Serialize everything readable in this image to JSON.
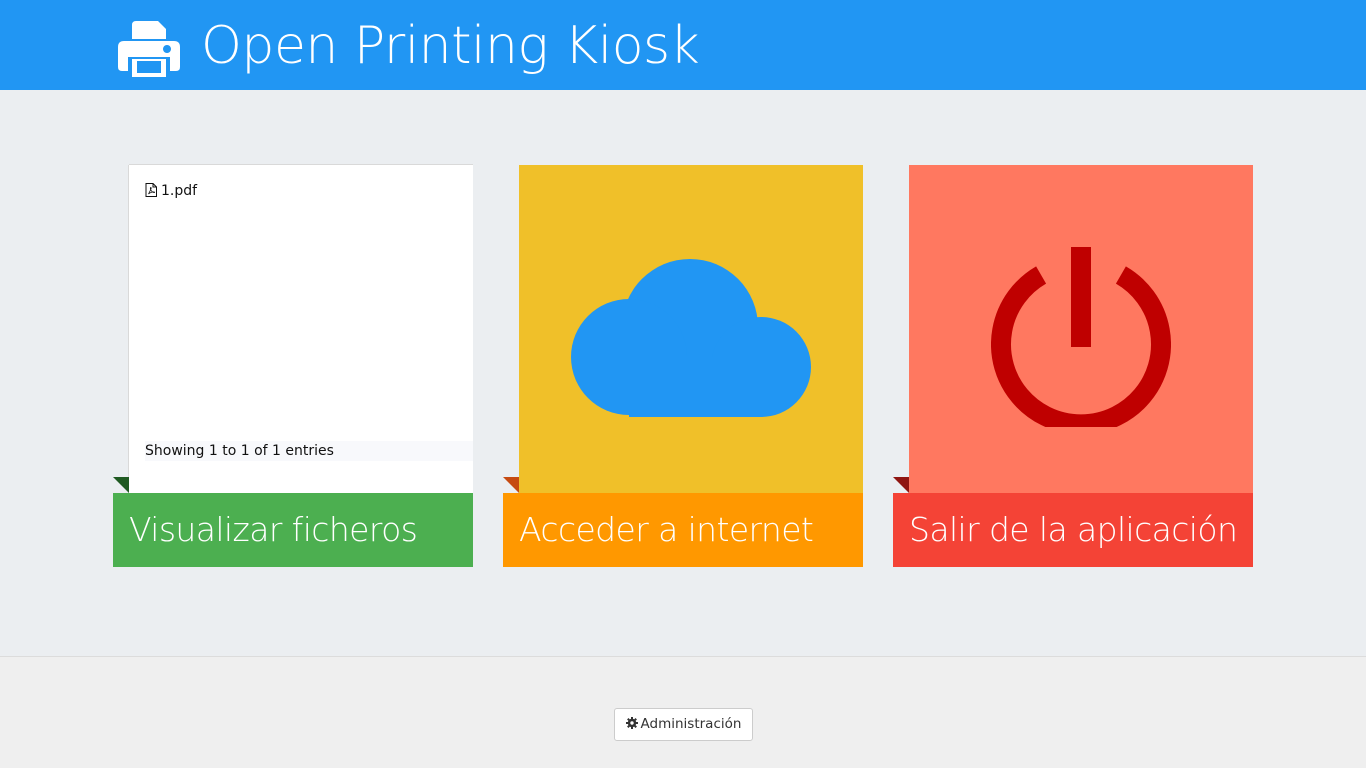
{
  "header": {
    "title": "Open Printing Kiosk",
    "icon": "printer-icon",
    "background": "#2196f3"
  },
  "tiles": [
    {
      "id": "files",
      "label": "Visualizar ficheros",
      "color": "#4caf50",
      "panel_color": "#ffffff",
      "files": [
        {
          "name": "1.pdf",
          "icon": "file-pdf-icon"
        }
      ],
      "table_info": "Showing 1 to 1 of 1 entries"
    },
    {
      "id": "internet",
      "label": "Acceder a internet",
      "color": "#ff9800",
      "panel_color": "#f0c029",
      "icon": "cloud-icon",
      "icon_color": "#2196f3"
    },
    {
      "id": "exit",
      "label": "Salir de la aplicación",
      "color": "#f44336",
      "panel_color": "#ff7860",
      "icon": "power-icon",
      "icon_color": "#bf0000"
    }
  ],
  "footer": {
    "admin_label": "Administración",
    "admin_icon": "gear-icon"
  }
}
